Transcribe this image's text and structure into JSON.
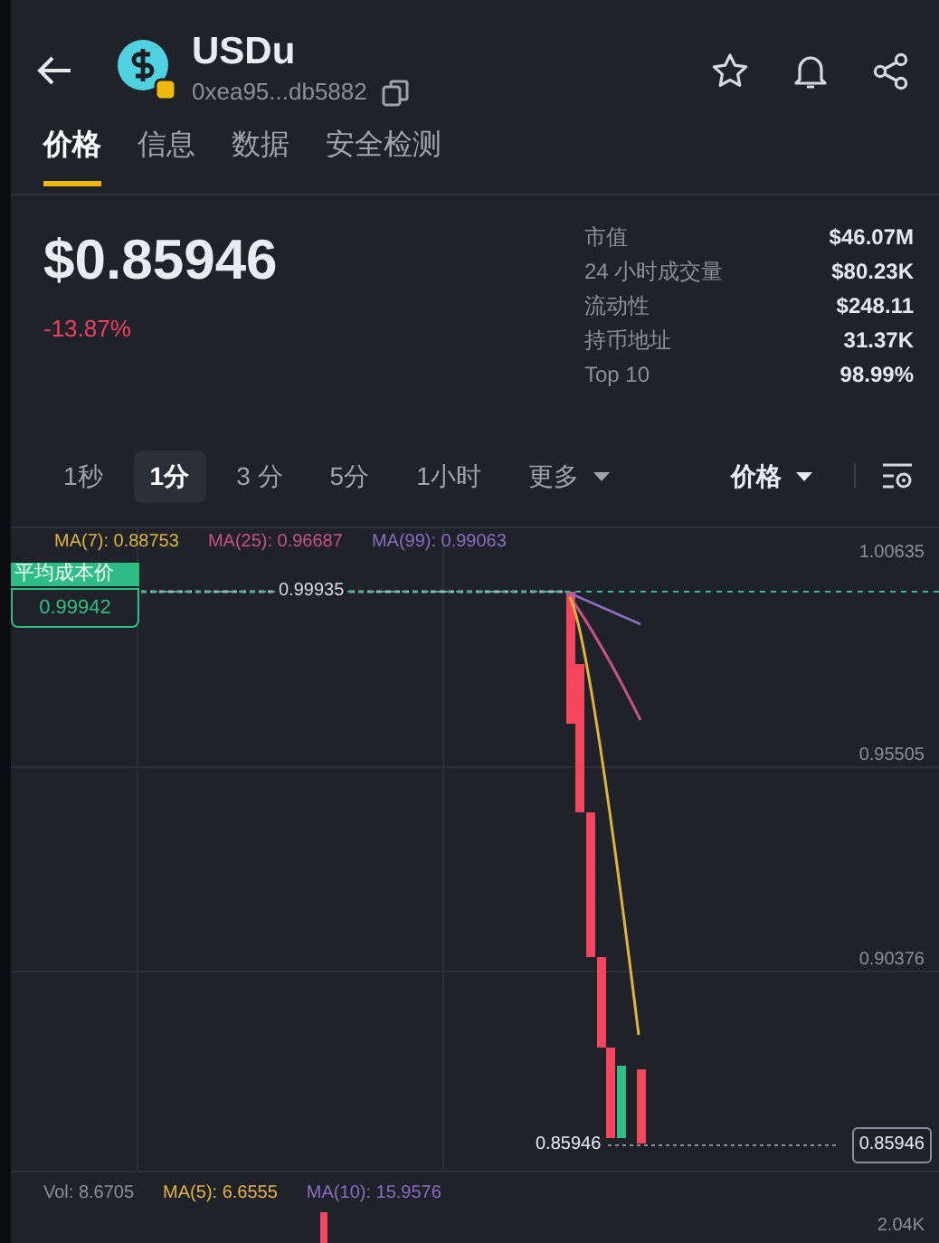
{
  "header": {
    "title": "USDu",
    "address": "0xea95...db5882"
  },
  "tabs": [
    {
      "label": "价格",
      "selected": true
    },
    {
      "label": "信息",
      "selected": false
    },
    {
      "label": "数据",
      "selected": false
    },
    {
      "label": "安全检测",
      "selected": false
    }
  ],
  "price": "$0.85946",
  "change": "-13.87%",
  "stats": [
    {
      "label": "市值",
      "value": "$46.07M"
    },
    {
      "label": "24 小时成交量",
      "value": "$80.23K"
    },
    {
      "label": "流动性",
      "value": "$248.11"
    },
    {
      "label": "持币地址",
      "value": "31.37K"
    },
    {
      "label": "Top 10",
      "value": "98.99%"
    }
  ],
  "intervals": [
    {
      "label": "1秒",
      "selected": false,
      "kind": "plain"
    },
    {
      "label": "1分",
      "selected": true,
      "kind": "plain"
    },
    {
      "label": "3 分",
      "selected": false,
      "kind": "plain"
    },
    {
      "label": "5分",
      "selected": false,
      "kind": "plain"
    },
    {
      "label": "1小时",
      "selected": false,
      "kind": "plain"
    },
    {
      "label": "更多",
      "selected": false,
      "kind": "dropdown"
    }
  ],
  "chart_type": "价格",
  "chart": {
    "ma_legend": [
      {
        "label": "MA(7): 0.88753",
        "color": "#e0b33a"
      },
      {
        "label": "MA(25): 0.96687",
        "color": "#c8508a"
      },
      {
        "label": "MA(99): 0.99063",
        "color": "#8a6cc0"
      }
    ],
    "y_labels": [
      "1.00635",
      "0.95505",
      "0.90376"
    ],
    "avg_cost": {
      "label": "平均成本价",
      "value": "0.99942"
    },
    "flat_label": "0.99935",
    "low_label": "0.85946",
    "current_price": "0.85946"
  },
  "volume": {
    "legend": [
      {
        "label": "Vol: 8.6705",
        "color": "#8a8f99"
      },
      {
        "label": "MA(5): 6.6555",
        "color": "#e0b33a"
      },
      {
        "label": "MA(10): 15.9576",
        "color": "#8a6cc0"
      }
    ],
    "y_label": "2.04K"
  }
}
